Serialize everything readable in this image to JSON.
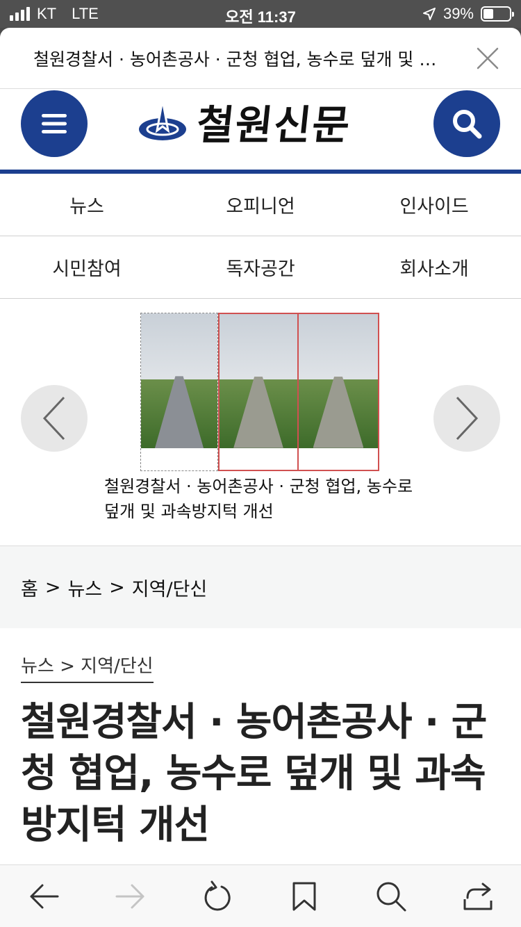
{
  "status_bar": {
    "carrier": "KT",
    "network": "LTE",
    "time": "오전 11:37",
    "battery": "39%",
    "battery_level": 0.39
  },
  "sheet": {
    "title": "철원경찰서 · 농어촌공사 · 군청 협업, 농수로 덮개 및 과속방지턱 개선"
  },
  "site": {
    "logo_text": "철원신문",
    "brand_color": "#1c3f8f"
  },
  "nav": {
    "items": [
      "뉴스",
      "오피니언",
      "인사이드",
      "시민참여",
      "독자공간",
      "회사소개"
    ]
  },
  "featured": {
    "caption": "철원경찰서 · 농어촌공사 · 군청 협업, 농수로 덮개 및 과속방지턱 개선"
  },
  "breadcrumb": {
    "home": "홈",
    "section": "뉴스",
    "subsection": "지역/단신",
    "separator": ">"
  },
  "article": {
    "category": "뉴스 > 지역/단신",
    "title": "철원경찰서 · 농어촌공사 · 군청 협업, 농수로 덮개 및 과속방지턱 개선"
  },
  "toolbar": {
    "icons": [
      "back-arrow-icon",
      "forward-arrow-icon",
      "reload-icon",
      "bookmark-icon",
      "search-icon",
      "share-icon"
    ]
  }
}
